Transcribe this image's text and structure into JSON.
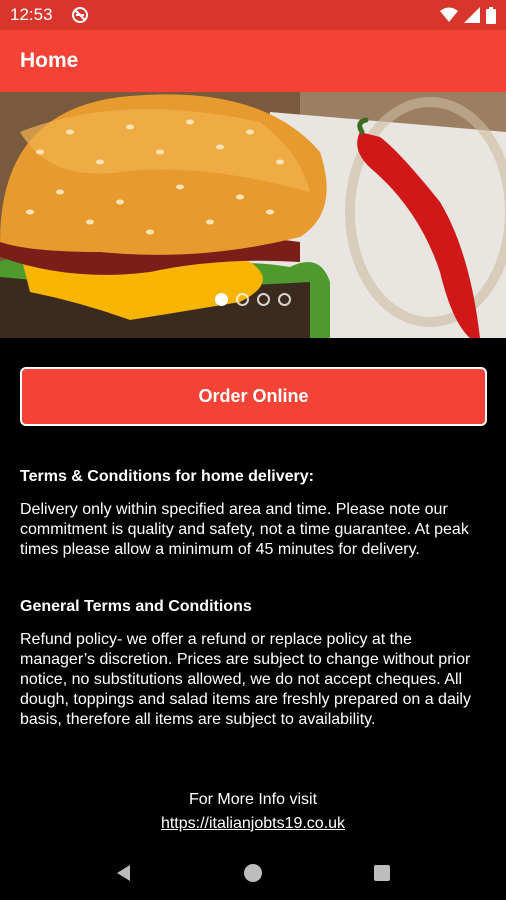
{
  "status_bar": {
    "time": "12:53",
    "icons": [
      "do-not-disturb-icon",
      "wifi-icon",
      "signal-icon",
      "battery-icon"
    ]
  },
  "app_bar": {
    "title": "Home"
  },
  "hero": {
    "image_subject": "burger-with-chili-photo",
    "carousel_slide_count": 4,
    "carousel_active_index": 0
  },
  "order_button": {
    "label": "Order Online"
  },
  "terms_delivery": {
    "heading": "Terms & Conditions for home delivery:",
    "body": "Delivery only within specified area and time. Please note our commitment is quality and safety, not a time guarantee. At peak times please allow a minimum of 45 minutes for delivery."
  },
  "terms_general": {
    "heading": "General Terms and Conditions",
    "body": "Refund policy- we offer a refund or replace policy at the manager’s discretion. Prices are subject to change without prior notice, no substitutions allowed, we do not accept cheques. All dough, toppings and salad items are freshly prepared on a daily basis, therefore all items are subject to availability."
  },
  "more_info": {
    "label": "For More Info visit",
    "link": "https://italianjobts19.co.uk"
  },
  "nav_bar": {
    "buttons": [
      "back-icon",
      "home-icon",
      "recents-icon"
    ]
  },
  "colors": {
    "status_bar": "#d8362c",
    "accent": "#f44336",
    "background": "#000000",
    "text": "#ffffff"
  }
}
